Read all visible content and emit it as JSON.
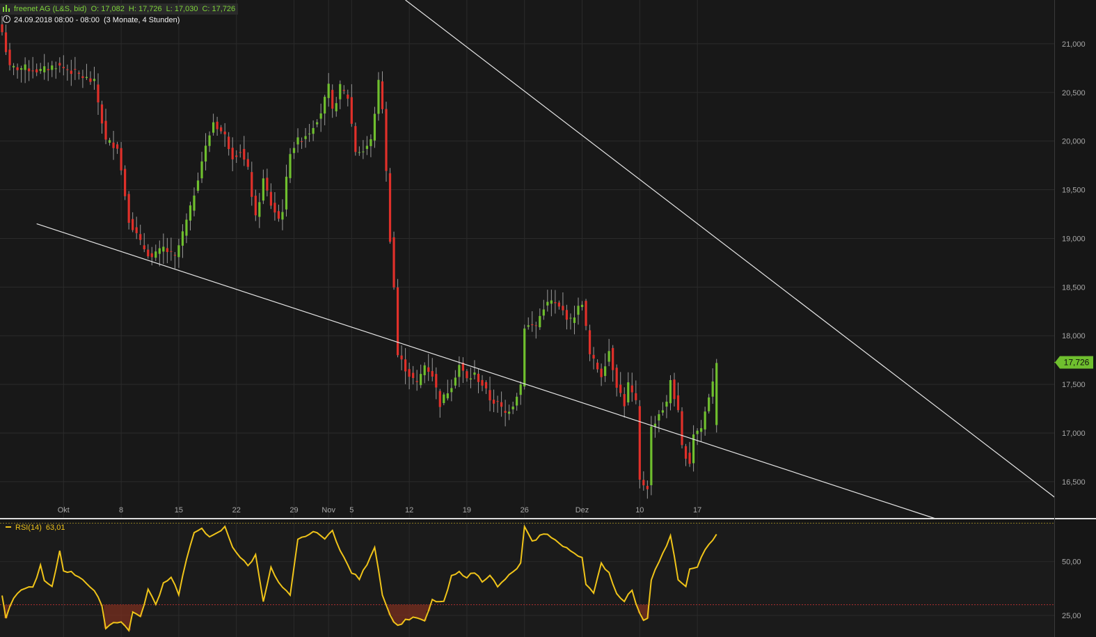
{
  "header": {
    "instrument": "freenet AG (L&S, bid)",
    "open": "O: 17,082",
    "high": "H: 17,726",
    "low": "L: 17,030",
    "close": "C: 17,726",
    "date": "24.09.2018 08:00 - 08:00",
    "range": "(3 Monate, 4 Stunden)"
  },
  "colors": {
    "background": "#161616",
    "grid": "#2b2b2b",
    "up": "#6fbf2e",
    "down": "#e0302a",
    "trendline": "#e6e6e6",
    "rsi": "#f0c419",
    "price_tag": "#6fbf2e"
  },
  "chart_data": [
    {
      "type": "candlestick",
      "y_ticks": [
        "21,000",
        "20,500",
        "20,000",
        "19,500",
        "19,000",
        "18,500",
        "18,000",
        "17,500",
        "17,000",
        "16,500"
      ],
      "y_tick_values": [
        21.0,
        20.5,
        20.0,
        19.5,
        19.0,
        18.5,
        18.0,
        17.5,
        17.0,
        16.5
      ],
      "ylim": [
        16.12,
        21.45
      ],
      "x_ticks": [
        "Okt",
        "8",
        "15",
        "22",
        "29",
        "Nov",
        "5",
        "12",
        "19",
        "26",
        "Dez",
        "10",
        "17"
      ],
      "x_tick_index": [
        16,
        31,
        46,
        61,
        76,
        85,
        91,
        106,
        121,
        136,
        151,
        166,
        181
      ],
      "bar_count": 187,
      "last_price_label": "17,726",
      "last_price": 17.726,
      "anchors": [
        [
          0,
          21.12
        ],
        [
          2,
          20.75
        ],
        [
          6,
          20.75
        ],
        [
          10,
          20.72
        ],
        [
          14,
          20.78
        ],
        [
          18,
          20.72
        ],
        [
          24,
          20.6
        ],
        [
          27,
          20.0
        ],
        [
          30,
          19.95
        ],
        [
          33,
          19.2
        ],
        [
          36,
          18.95
        ],
        [
          39,
          18.8
        ],
        [
          42,
          18.9
        ],
        [
          45,
          18.8
        ],
        [
          49,
          19.3
        ],
        [
          52,
          19.8
        ],
        [
          55,
          20.2
        ],
        [
          58,
          20.05
        ],
        [
          60,
          19.85
        ],
        [
          62,
          19.9
        ],
        [
          64,
          19.7
        ],
        [
          66,
          19.2
        ],
        [
          68,
          19.6
        ],
        [
          70,
          19.35
        ],
        [
          72,
          19.2
        ],
        [
          73,
          19.3
        ],
        [
          75,
          19.9
        ],
        [
          77,
          20.0
        ],
        [
          80,
          20.1
        ],
        [
          83,
          20.3
        ],
        [
          85,
          20.55
        ],
        [
          86,
          20.3
        ],
        [
          88,
          20.55
        ],
        [
          90,
          20.45
        ],
        [
          92,
          19.9
        ],
        [
          94,
          19.9
        ],
        [
          96,
          20.0
        ],
        [
          98,
          20.6
        ],
        [
          99,
          20.35
        ],
        [
          101,
          19.0
        ],
        [
          102,
          18.5
        ],
        [
          103,
          17.8
        ],
        [
          106,
          17.6
        ],
        [
          108,
          17.5
        ],
        [
          110,
          17.7
        ],
        [
          112,
          17.6
        ],
        [
          114,
          17.3
        ],
        [
          117,
          17.5
        ],
        [
          119,
          17.7
        ],
        [
          121,
          17.55
        ],
        [
          123,
          17.6
        ],
        [
          125,
          17.5
        ],
        [
          127,
          17.35
        ],
        [
          129,
          17.3
        ],
        [
          131,
          17.2
        ],
        [
          133,
          17.3
        ],
        [
          135,
          17.5
        ],
        [
          136,
          18.1
        ],
        [
          139,
          18.1
        ],
        [
          141,
          18.3
        ],
        [
          143,
          18.35
        ],
        [
          146,
          18.25
        ],
        [
          148,
          18.15
        ],
        [
          151,
          18.35
        ],
        [
          153,
          17.8
        ],
        [
          156,
          17.6
        ],
        [
          158,
          17.85
        ],
        [
          160,
          17.5
        ],
        [
          162,
          17.3
        ],
        [
          163,
          17.5
        ],
        [
          165,
          17.3
        ],
        [
          166,
          16.5
        ],
        [
          168,
          16.45
        ],
        [
          169,
          17.05
        ],
        [
          171,
          17.2
        ],
        [
          173,
          17.3
        ],
        [
          174,
          17.55
        ],
        [
          176,
          17.2
        ],
        [
          177,
          16.85
        ],
        [
          179,
          16.7
        ],
        [
          180,
          17.0
        ],
        [
          182,
          17.05
        ],
        [
          186,
          17.72
        ]
      ]
    },
    {
      "type": "line",
      "indicator": "RSI(14)",
      "last_value": "63,01",
      "y_ticks": [
        "50,00",
        "25,00"
      ],
      "y_tick_values": [
        50,
        25
      ],
      "ylim": [
        15,
        68
      ],
      "reference_lines": [
        30,
        70
      ],
      "anchors": [
        [
          0,
          34
        ],
        [
          1,
          24
        ],
        [
          3,
          33
        ],
        [
          6,
          38
        ],
        [
          8,
          38
        ],
        [
          10,
          48
        ],
        [
          11,
          41
        ],
        [
          13,
          38
        ],
        [
          15,
          55
        ],
        [
          16,
          46
        ],
        [
          18,
          45
        ],
        [
          21,
          42
        ],
        [
          24,
          36
        ],
        [
          26,
          30
        ],
        [
          27,
          19
        ],
        [
          29,
          22
        ],
        [
          31,
          22
        ],
        [
          33,
          18
        ],
        [
          34,
          27
        ],
        [
          36,
          24
        ],
        [
          38,
          37
        ],
        [
          40,
          30
        ],
        [
          42,
          40
        ],
        [
          44,
          43
        ],
        [
          46,
          35
        ],
        [
          48,
          51
        ],
        [
          50,
          63
        ],
        [
          52,
          66
        ],
        [
          54,
          61
        ],
        [
          56,
          63
        ],
        [
          58,
          66
        ],
        [
          60,
          57
        ],
        [
          62,
          52
        ],
        [
          64,
          48
        ],
        [
          66,
          53
        ],
        [
          68,
          32
        ],
        [
          70,
          47
        ],
        [
          72,
          40
        ],
        [
          75,
          34
        ],
        [
          77,
          60
        ],
        [
          79,
          62
        ],
        [
          82,
          64
        ],
        [
          84,
          60
        ],
        [
          86,
          65
        ],
        [
          88,
          55
        ],
        [
          91,
          45
        ],
        [
          93,
          42
        ],
        [
          95,
          49
        ],
        [
          97,
          57
        ],
        [
          99,
          35
        ],
        [
          101,
          25
        ],
        [
          103,
          20
        ],
        [
          105,
          23
        ],
        [
          108,
          24
        ],
        [
          110,
          22
        ],
        [
          112,
          32
        ],
        [
          115,
          31
        ],
        [
          117,
          43
        ],
        [
          119,
          45
        ],
        [
          121,
          43
        ],
        [
          123,
          45
        ],
        [
          125,
          41
        ],
        [
          127,
          44
        ],
        [
          129,
          38
        ],
        [
          131,
          42
        ],
        [
          133,
          45
        ],
        [
          135,
          49
        ],
        [
          136,
          66
        ],
        [
          138,
          59
        ],
        [
          140,
          62
        ],
        [
          142,
          63
        ],
        [
          144,
          60
        ],
        [
          146,
          57
        ],
        [
          148,
          55
        ],
        [
          151,
          52
        ],
        [
          152,
          40
        ],
        [
          154,
          35
        ],
        [
          156,
          49
        ],
        [
          158,
          45
        ],
        [
          160,
          35
        ],
        [
          162,
          32
        ],
        [
          164,
          37
        ],
        [
          165,
          30
        ],
        [
          167,
          23
        ],
        [
          168,
          24
        ],
        [
          169,
          42
        ],
        [
          171,
          50
        ],
        [
          173,
          57
        ],
        [
          174,
          62
        ],
        [
          176,
          42
        ],
        [
          178,
          38
        ],
        [
          179,
          46
        ],
        [
          181,
          48
        ],
        [
          183,
          55
        ],
        [
          186,
          63
        ]
      ]
    }
  ]
}
